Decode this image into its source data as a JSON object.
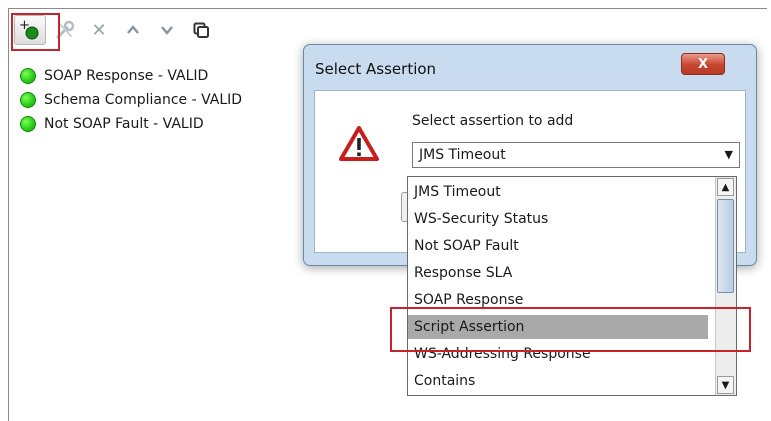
{
  "toolbar": {
    "buttons": [
      {
        "name": "add-assertion",
        "icon": "add-assertion-icon"
      },
      {
        "name": "configure",
        "icon": "wrench-icon"
      },
      {
        "name": "remove",
        "icon": "close-icon",
        "glyph": "✕"
      },
      {
        "name": "move-up",
        "icon": "chevron-up-icon",
        "glyph": "^"
      },
      {
        "name": "move-down",
        "icon": "chevron-down-icon",
        "glyph": "v"
      },
      {
        "name": "copy",
        "icon": "copy-icon"
      }
    ]
  },
  "assertions": [
    {
      "label": "SOAP Response - VALID",
      "status": "valid"
    },
    {
      "label": "Schema Compliance - VALID",
      "status": "valid"
    },
    {
      "label": "Not SOAP Fault - VALID",
      "status": "valid"
    }
  ],
  "dialog": {
    "title": "Select Assertion",
    "close_glyph": "X",
    "prompt": "Select assertion to add",
    "selected_value": "JMS Timeout",
    "select_arrow": "▼"
  },
  "dropdown": {
    "options": [
      "JMS Timeout",
      "WS-Security Status",
      "Not SOAP Fault",
      "Response SLA",
      "SOAP Response",
      "Script Assertion",
      "WS-Addressing Response",
      "Contains"
    ],
    "highlighted": "Script Assertion",
    "scroll_up_glyph": "▲",
    "scroll_down_glyph": "▼"
  },
  "colors": {
    "highlight_box": "#c4252b",
    "valid_status": "#2bd11a",
    "dialog_frame": "#c9dcef",
    "selected_row": "#a9a9a9"
  }
}
